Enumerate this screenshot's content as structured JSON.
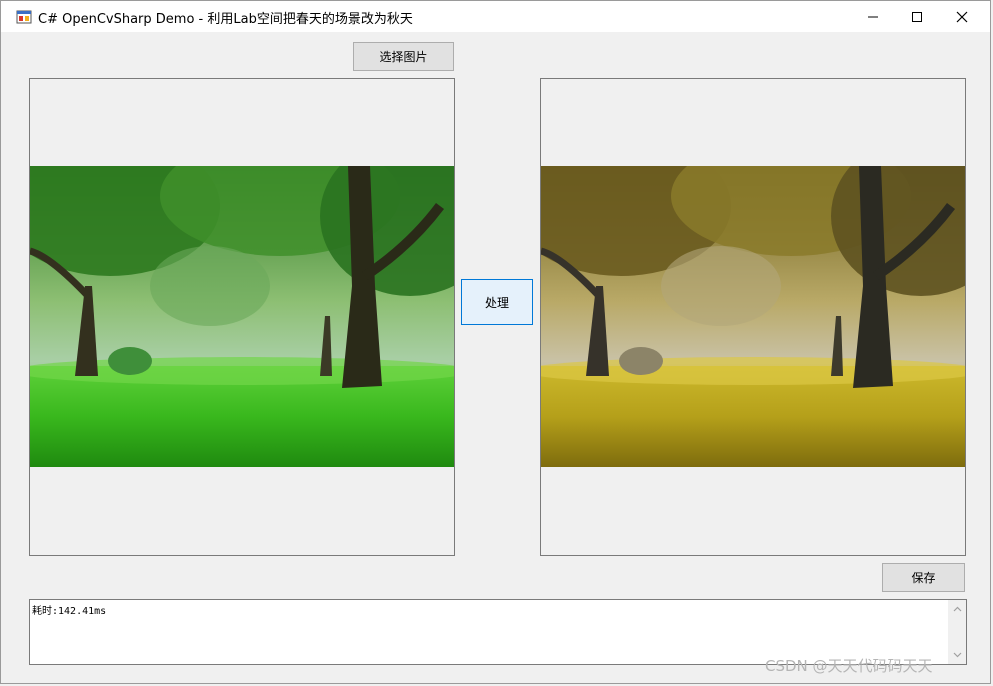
{
  "window": {
    "title": "C# OpenCvSharp Demo - 利用Lab空间把春天的场景改为秋天",
    "controls": {
      "minimize": "minimize-icon",
      "maximize": "maximize-icon",
      "close": "close-icon"
    }
  },
  "buttons": {
    "select_image": "选择图片",
    "process": "处理",
    "save": "保存"
  },
  "log": {
    "text": "耗时:142.41ms"
  },
  "images": {
    "source": "spring-park-scene",
    "result": "autumn-park-scene"
  },
  "watermark": "CSDN @天天代码码天天",
  "colors": {
    "window_bg": "#f0f0f0",
    "button_bg": "#e1e1e1",
    "focus_border": "#0078d7",
    "spring_grass": "#3fc21e",
    "autumn_grass": "#b8a61a"
  }
}
